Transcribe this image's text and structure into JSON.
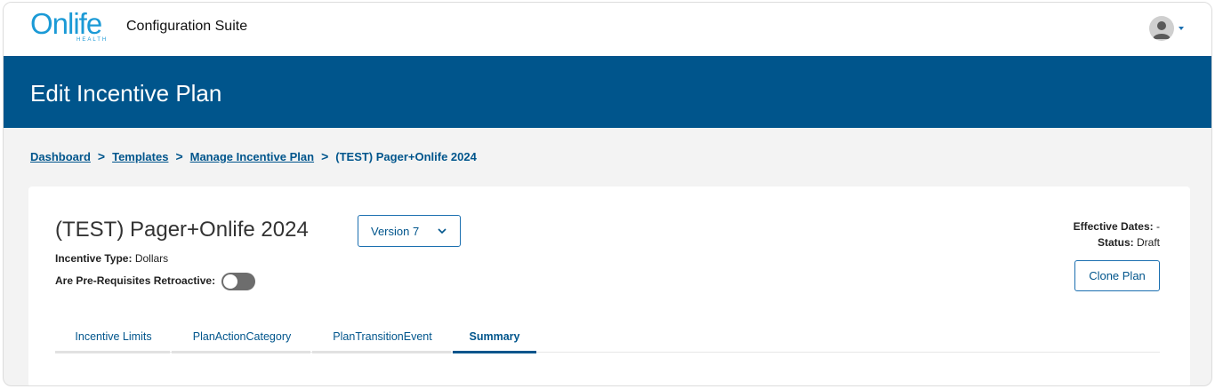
{
  "app": {
    "logo_text": "Onlife",
    "logo_subtext": "HEALTH",
    "suite_title": "Configuration Suite"
  },
  "user_menu": {
    "avatar_icon": "user-avatar-icon",
    "caret_icon": "caret-down-icon"
  },
  "header": {
    "title": "Edit Incentive Plan"
  },
  "breadcrumb": {
    "items": [
      "Dashboard",
      "Templates",
      "Manage Incentive Plan"
    ],
    "current": "(TEST) Pager+Onlife 2024",
    "separator": ">"
  },
  "plan": {
    "title": "(TEST) Pager+Onlife 2024",
    "version_selected": "Version 7",
    "incentive_type_label": "Incentive Type:",
    "incentive_type_value": "Dollars",
    "prereq_label": "Are Pre-Requisites Retroactive:",
    "prereq_retroactive": false,
    "effective_dates_label": "Effective Dates:",
    "effective_dates_value": "-",
    "status_label": "Status:",
    "status_value": "Draft",
    "clone_button": "Clone Plan"
  },
  "tabs": [
    {
      "label": "Incentive Limits",
      "active": false
    },
    {
      "label": "PlanActionCategory",
      "active": false
    },
    {
      "label": "PlanTransitionEvent",
      "active": false
    },
    {
      "label": "Summary",
      "active": true
    }
  ],
  "colors": {
    "brand_blue": "#00558c",
    "logo_blue": "#1b9ad6",
    "toggle_off": "#6d6d6d"
  }
}
